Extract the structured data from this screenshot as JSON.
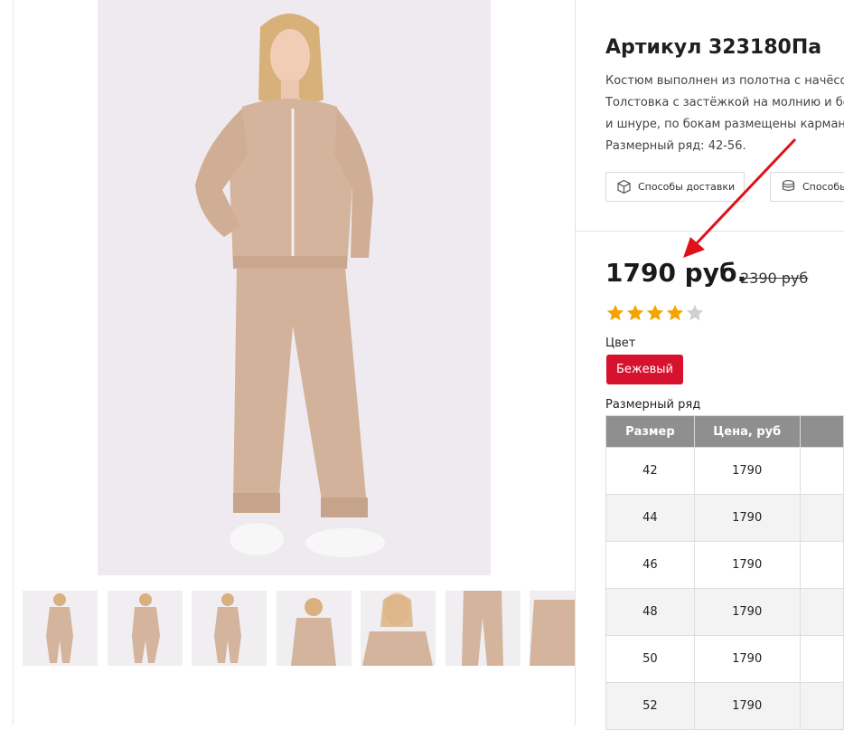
{
  "product": {
    "title": "Артикул 323180Па",
    "description_lines": [
      "Костюм выполнен из полотна с начёсо",
      "Толстовка с застёжкой на молнию и бо",
      "и шнуре, по бокам размещены кармань",
      "Размерный ряд: 42-56."
    ],
    "buttons": {
      "delivery": "Способы доставки",
      "payment": "Способы"
    },
    "price": "1790 руб.",
    "old_price": "2390 руб",
    "rating": 4,
    "rating_max": 5,
    "color_label": "Цвет",
    "color_option": "Бежевый",
    "size_label": "Размерный ряд"
  },
  "colors": {
    "accent_red": "#d7122f",
    "star_filled": "#f5a300",
    "star_empty": "#d0d0d0",
    "table_header": "#8f8f8f",
    "garment_beige": "#d4b49c"
  },
  "size_table": {
    "headers": [
      "Размер",
      "Цена, руб",
      ""
    ],
    "rows": [
      [
        "42",
        "1790",
        ""
      ],
      [
        "44",
        "1790",
        ""
      ],
      [
        "46",
        "1790",
        ""
      ],
      [
        "48",
        "1790",
        ""
      ],
      [
        "50",
        "1790",
        ""
      ],
      [
        "52",
        "1790",
        ""
      ]
    ]
  },
  "gallery": {
    "thumbnail_count": 7
  }
}
